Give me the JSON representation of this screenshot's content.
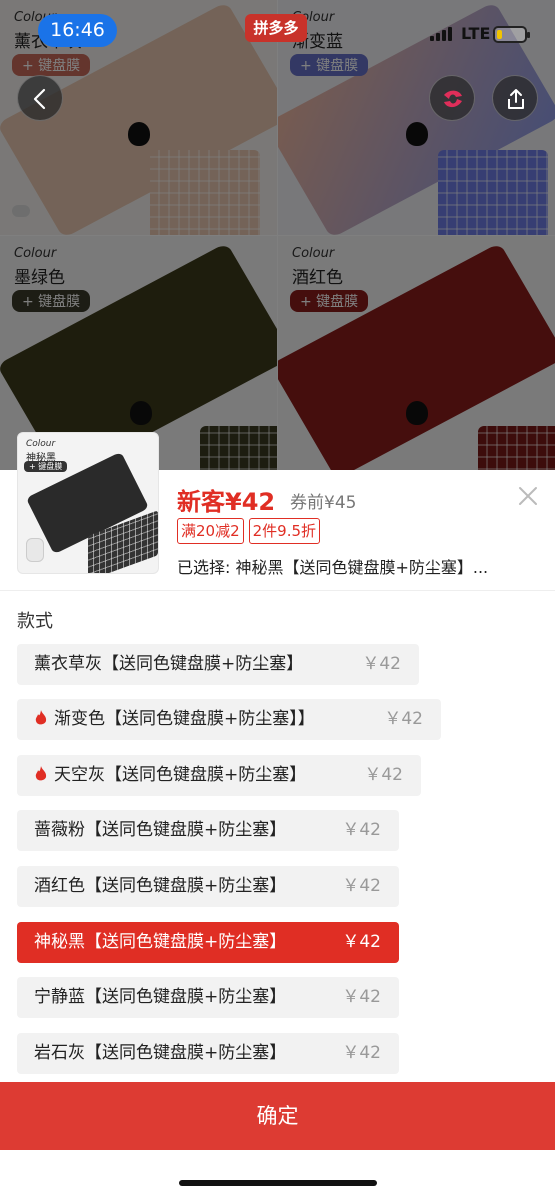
{
  "status_bar": {
    "time": "16:46",
    "network": "LTE",
    "battery_level": 0.15
  },
  "app_badge": "拼多多",
  "background_tiles": [
    {
      "colour_label": "Colour",
      "name": "薰衣草灰",
      "keyboard_label": "+ 键盘膜",
      "color": "#e8c7b0",
      "tag_color": "#c86b5a"
    },
    {
      "colour_label": "Colour",
      "name": "渐变蓝",
      "keyboard_label": "+ 键盘膜",
      "color": "#9aa4e6",
      "tag_color": "#6670c8"
    },
    {
      "colour_label": "Colour",
      "name": "墨绿色",
      "keyboard_label": "+ 键盘膜",
      "color": "#3d3a1a",
      "tag_color": "#3a3a2a"
    },
    {
      "colour_label": "Colour",
      "name": "酒红色",
      "keyboard_label": "+ 键盘膜",
      "color": "#8a1c1a",
      "tag_color": "#8a1c1a"
    }
  ],
  "sheet": {
    "thumbnail": {
      "colour_label": "Colour",
      "name": "神秘黑",
      "keyboard_label": "+ 键盘膜"
    },
    "price_main": "新客¥42",
    "price_before": "券前¥45",
    "coupons": [
      "满20减2",
      "2件9.5折"
    ],
    "selected_text": "已选择: 神秘黑【送同色键盘膜+防尘塞】...",
    "section_title": "款式",
    "options": [
      {
        "label": "薰衣草灰【送同色键盘膜+防尘塞】",
        "price": "￥42",
        "hot": false,
        "selected": false
      },
      {
        "label": "渐变色【送同色键盘膜+防尘塞】】",
        "price": "￥42",
        "hot": true,
        "selected": false
      },
      {
        "label": "天空灰【送同色键盘膜+防尘塞】",
        "price": "￥42",
        "hot": true,
        "selected": false
      },
      {
        "label": "蔷薇粉【送同色键盘膜+防尘塞】",
        "price": "￥42",
        "hot": false,
        "selected": false
      },
      {
        "label": "酒红色【送同色键盘膜+防尘塞】",
        "price": "￥42",
        "hot": false,
        "selected": false
      },
      {
        "label": "神秘黑【送同色键盘膜+防尘塞】",
        "price": "￥42",
        "hot": false,
        "selected": true
      },
      {
        "label": "宁静蓝【送同色键盘膜+防尘塞】",
        "price": "￥42",
        "hot": false,
        "selected": false
      },
      {
        "label": "岩石灰【送同色键盘膜+防尘塞】",
        "price": "￥42",
        "hot": false,
        "selected": false
      }
    ],
    "confirm_label": "确定"
  },
  "colors": {
    "accent": "#e02e24",
    "confirm_bg": "#dd3b33"
  }
}
